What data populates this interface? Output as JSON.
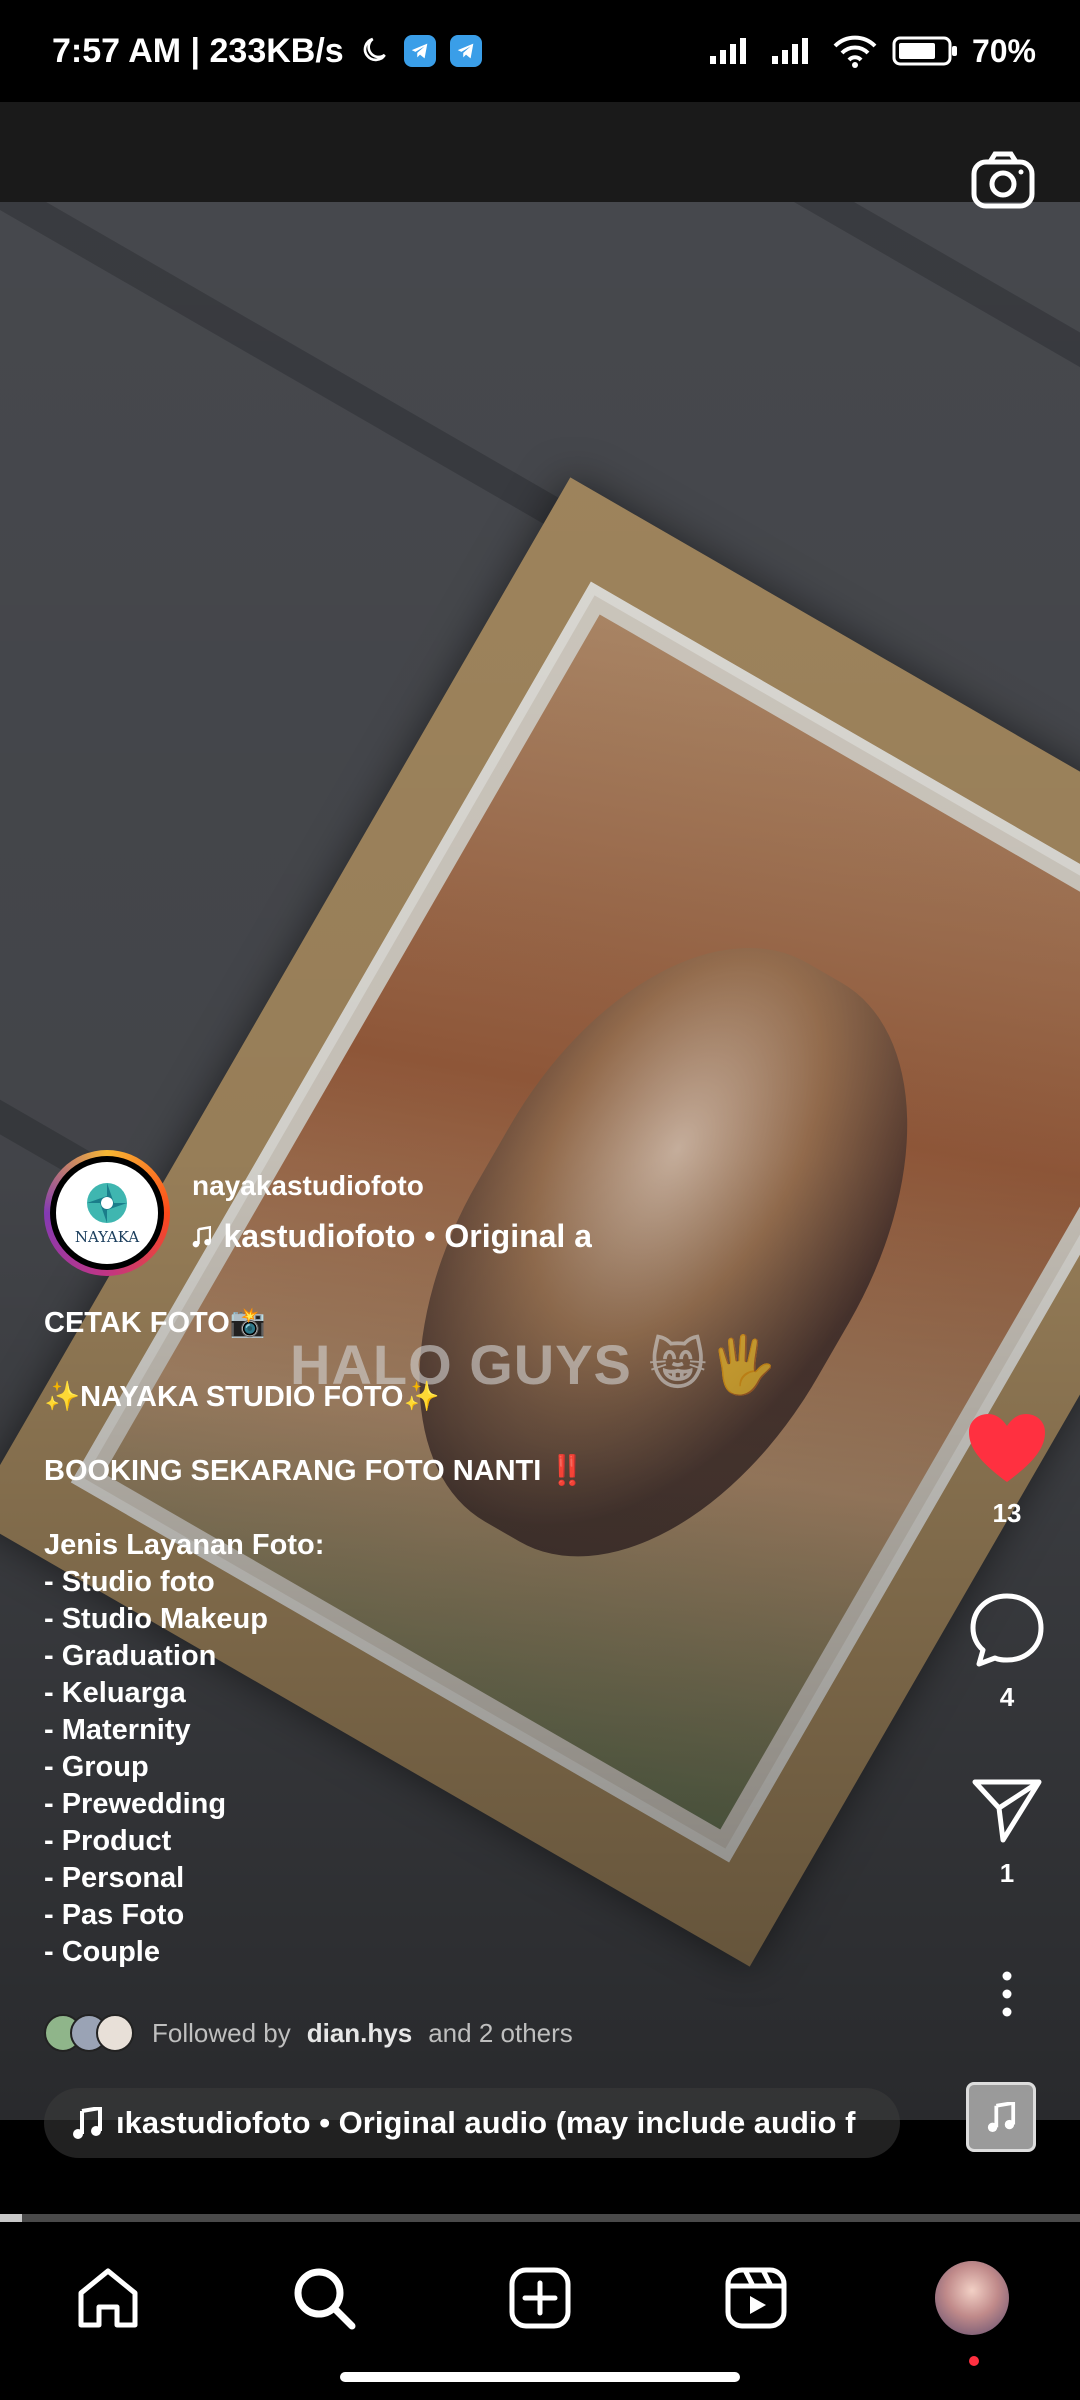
{
  "status_bar": {
    "time_speed": "7:57 AM | 233KB/s",
    "battery": "70%"
  },
  "video": {
    "overlay_text": "HALO GUYS 😸🖐"
  },
  "author": {
    "username": "nayakastudiofoto",
    "logo_text": "NAYAKA",
    "audio_snippet": "kastudiofoto • Original a"
  },
  "caption": {
    "lines": [
      "CETAK FOTO📸",
      "",
      "✨NAYAKA STUDIO FOTO✨",
      "",
      "BOOKING SEKARANG FOTO NANTI ‼️",
      "",
      "Jenis Layanan Foto:",
      "- Studio foto",
      "- Studio Makeup",
      "- Graduation",
      "- Keluarga",
      "- Maternity",
      "- Group",
      "- Prewedding",
      "- Product",
      "- Personal",
      "- Pas Foto",
      "- Couple"
    ]
  },
  "followed_by": {
    "prefix": "Followed by",
    "name": "dian.hys",
    "suffix": "and 2 others"
  },
  "audio_pill": {
    "text": "ıkastudiofoto • Original audio (may include audio f"
  },
  "actions": {
    "likes": "13",
    "comments": "4",
    "shares": "1"
  },
  "progress": {
    "fraction": 0.02
  },
  "colors": {
    "like_red": "#ff3040",
    "background": "#000000"
  },
  "icons": [
    "camera-icon",
    "heart-icon",
    "comment-icon",
    "share-icon",
    "more-icon",
    "music-note-icon",
    "home-icon",
    "search-icon",
    "create-icon",
    "reels-icon",
    "profile-avatar"
  ]
}
